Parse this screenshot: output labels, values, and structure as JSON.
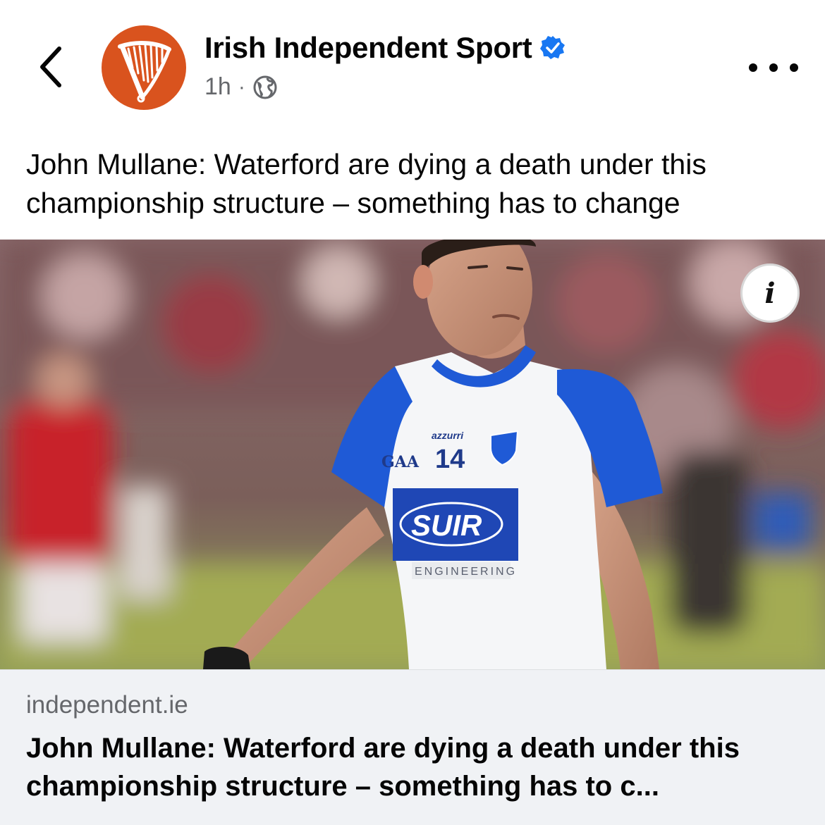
{
  "header": {
    "page_name": "Irish Independent Sport",
    "time": "1h",
    "separator": "·",
    "verified": true,
    "icons": {
      "back": "chevron-left-icon",
      "avatar": "harp-logo",
      "verified": "verified-badge-icon",
      "audience": "globe-icon",
      "more": "more-horizontal-icon"
    }
  },
  "post": {
    "text": "John Mullane: Waterford are dying a death under this championship structure – something has to change"
  },
  "link_preview": {
    "image_alt": "Waterford hurler wearing number 14 jersey",
    "jersey": {
      "sponsor": "SUIR",
      "sponsor_sub": "ENGINEERING",
      "number": "14",
      "brand": "azzurri",
      "badge": "GAA"
    },
    "info_icon": "info-icon",
    "domain": "independent.ie",
    "title": "John Mullane: Waterford are dying a death under this championship structure – something has to c..."
  },
  "colors": {
    "avatar_bg": "#d9531e",
    "verified_blue": "#1877f2",
    "secondary_text": "#65676b",
    "footer_bg": "#f0f2f5"
  }
}
